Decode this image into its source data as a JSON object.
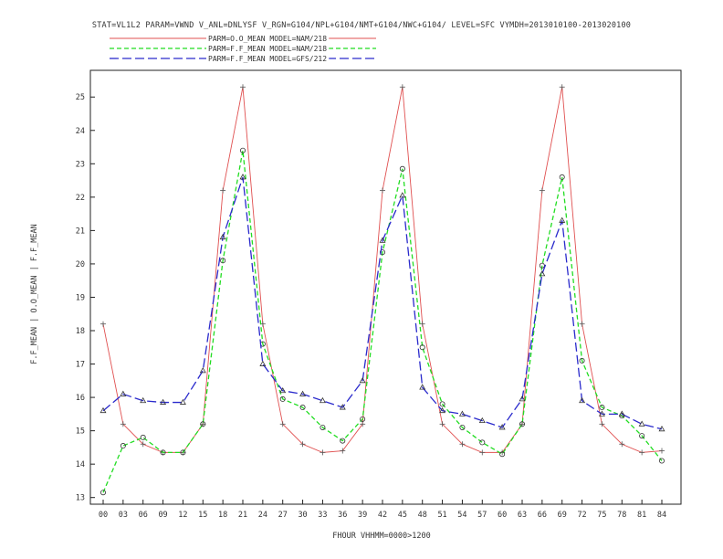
{
  "chart_data": {
    "type": "line",
    "title": "STAT=VL1L2 PARAM=VWND V_ANL=DNLYSF V_RGN=G104/NPL+G104/NMT+G104/NWC+G104/ LEVEL=SFC VYMDH=2013010100-2013020100",
    "xlabel": "FHOUR VHHMM=0000>1200",
    "ylabel": "F.F_MEAN | O.O_MEAN | F.F_MEAN",
    "categories": [
      "00",
      "03",
      "06",
      "09",
      "12",
      "15",
      "18",
      "21",
      "24",
      "27",
      "30",
      "33",
      "36",
      "39",
      "42",
      "45",
      "48",
      "51",
      "54",
      "57",
      "60",
      "63",
      "66",
      "69",
      "72",
      "75",
      "78",
      "81",
      "84"
    ],
    "ylim": [
      12.8,
      25.8
    ],
    "yticks": [
      13,
      14,
      15,
      16,
      17,
      18,
      19,
      20,
      21,
      22,
      23,
      24,
      25
    ],
    "grid": false,
    "legend_position": "top",
    "series": [
      {
        "name": "PARM=O.O_MEAN MODEL=NAM/218",
        "color": "#e05050",
        "marker": "plus",
        "dash": "solid",
        "values": [
          18.2,
          15.2,
          14.6,
          14.35,
          14.35,
          15.2,
          22.2,
          25.3,
          18.2,
          15.2,
          14.6,
          14.35,
          14.4,
          15.2,
          22.2,
          25.3,
          18.2,
          15.2,
          14.6,
          14.35,
          14.35,
          15.2,
          22.2,
          25.3,
          18.2,
          15.2,
          14.6,
          14.35,
          14.4
        ]
      },
      {
        "name": "PARM=F.F_MEAN MODEL=NAM/218",
        "color": "#22dd22",
        "marker": "circle",
        "dash": "short",
        "values": [
          13.15,
          14.55,
          14.8,
          14.35,
          14.35,
          15.2,
          20.1,
          23.4,
          17.6,
          15.95,
          15.7,
          15.1,
          14.7,
          15.35,
          20.35,
          22.85,
          17.5,
          15.8,
          15.1,
          14.65,
          14.3,
          15.2,
          19.95,
          22.6,
          17.1,
          15.7,
          15.45,
          14.85,
          14.1
        ]
      },
      {
        "name": "PARM=F.F_MEAN MODEL=GFS/212",
        "color": "#2a2acc",
        "marker": "triangle",
        "dash": "long",
        "values": [
          15.6,
          16.1,
          15.9,
          15.85,
          15.85,
          16.8,
          20.8,
          22.6,
          17.0,
          16.2,
          16.1,
          15.9,
          15.7,
          16.5,
          20.7,
          22.05,
          16.3,
          15.6,
          15.5,
          15.3,
          15.1,
          15.95,
          19.7,
          21.3,
          15.9,
          15.5,
          15.5,
          15.2,
          15.05
        ]
      }
    ]
  }
}
